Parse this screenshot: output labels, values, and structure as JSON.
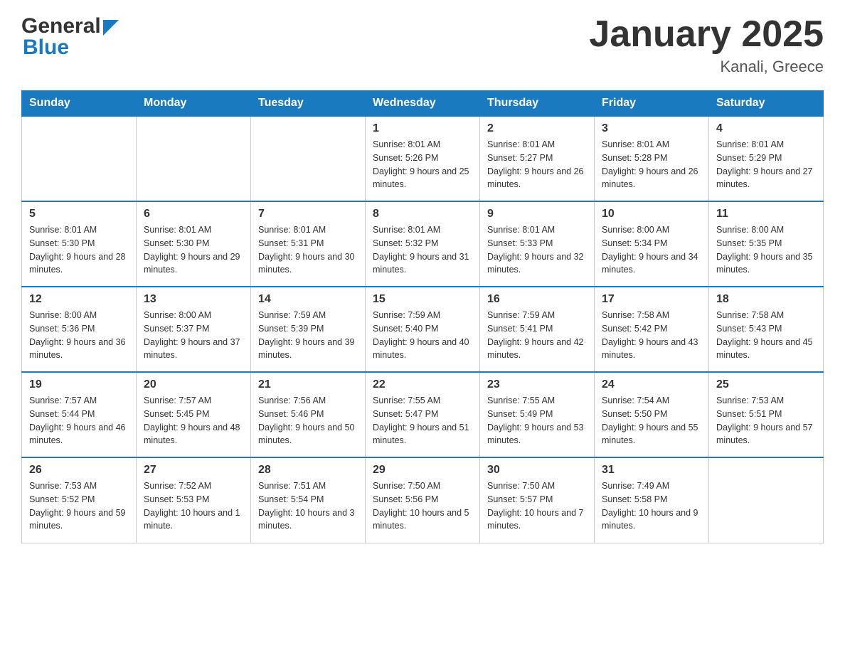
{
  "header": {
    "logo_general": "General",
    "logo_blue": "Blue",
    "title": "January 2025",
    "subtitle": "Kanali, Greece"
  },
  "days_of_week": [
    "Sunday",
    "Monday",
    "Tuesday",
    "Wednesday",
    "Thursday",
    "Friday",
    "Saturday"
  ],
  "weeks": [
    [
      {
        "day": "",
        "sunrise": "",
        "sunset": "",
        "daylight": ""
      },
      {
        "day": "",
        "sunrise": "",
        "sunset": "",
        "daylight": ""
      },
      {
        "day": "",
        "sunrise": "",
        "sunset": "",
        "daylight": ""
      },
      {
        "day": "1",
        "sunrise": "Sunrise: 8:01 AM",
        "sunset": "Sunset: 5:26 PM",
        "daylight": "Daylight: 9 hours and 25 minutes."
      },
      {
        "day": "2",
        "sunrise": "Sunrise: 8:01 AM",
        "sunset": "Sunset: 5:27 PM",
        "daylight": "Daylight: 9 hours and 26 minutes."
      },
      {
        "day": "3",
        "sunrise": "Sunrise: 8:01 AM",
        "sunset": "Sunset: 5:28 PM",
        "daylight": "Daylight: 9 hours and 26 minutes."
      },
      {
        "day": "4",
        "sunrise": "Sunrise: 8:01 AM",
        "sunset": "Sunset: 5:29 PM",
        "daylight": "Daylight: 9 hours and 27 minutes."
      }
    ],
    [
      {
        "day": "5",
        "sunrise": "Sunrise: 8:01 AM",
        "sunset": "Sunset: 5:30 PM",
        "daylight": "Daylight: 9 hours and 28 minutes."
      },
      {
        "day": "6",
        "sunrise": "Sunrise: 8:01 AM",
        "sunset": "Sunset: 5:30 PM",
        "daylight": "Daylight: 9 hours and 29 minutes."
      },
      {
        "day": "7",
        "sunrise": "Sunrise: 8:01 AM",
        "sunset": "Sunset: 5:31 PM",
        "daylight": "Daylight: 9 hours and 30 minutes."
      },
      {
        "day": "8",
        "sunrise": "Sunrise: 8:01 AM",
        "sunset": "Sunset: 5:32 PM",
        "daylight": "Daylight: 9 hours and 31 minutes."
      },
      {
        "day": "9",
        "sunrise": "Sunrise: 8:01 AM",
        "sunset": "Sunset: 5:33 PM",
        "daylight": "Daylight: 9 hours and 32 minutes."
      },
      {
        "day": "10",
        "sunrise": "Sunrise: 8:00 AM",
        "sunset": "Sunset: 5:34 PM",
        "daylight": "Daylight: 9 hours and 34 minutes."
      },
      {
        "day": "11",
        "sunrise": "Sunrise: 8:00 AM",
        "sunset": "Sunset: 5:35 PM",
        "daylight": "Daylight: 9 hours and 35 minutes."
      }
    ],
    [
      {
        "day": "12",
        "sunrise": "Sunrise: 8:00 AM",
        "sunset": "Sunset: 5:36 PM",
        "daylight": "Daylight: 9 hours and 36 minutes."
      },
      {
        "day": "13",
        "sunrise": "Sunrise: 8:00 AM",
        "sunset": "Sunset: 5:37 PM",
        "daylight": "Daylight: 9 hours and 37 minutes."
      },
      {
        "day": "14",
        "sunrise": "Sunrise: 7:59 AM",
        "sunset": "Sunset: 5:39 PM",
        "daylight": "Daylight: 9 hours and 39 minutes."
      },
      {
        "day": "15",
        "sunrise": "Sunrise: 7:59 AM",
        "sunset": "Sunset: 5:40 PM",
        "daylight": "Daylight: 9 hours and 40 minutes."
      },
      {
        "day": "16",
        "sunrise": "Sunrise: 7:59 AM",
        "sunset": "Sunset: 5:41 PM",
        "daylight": "Daylight: 9 hours and 42 minutes."
      },
      {
        "day": "17",
        "sunrise": "Sunrise: 7:58 AM",
        "sunset": "Sunset: 5:42 PM",
        "daylight": "Daylight: 9 hours and 43 minutes."
      },
      {
        "day": "18",
        "sunrise": "Sunrise: 7:58 AM",
        "sunset": "Sunset: 5:43 PM",
        "daylight": "Daylight: 9 hours and 45 minutes."
      }
    ],
    [
      {
        "day": "19",
        "sunrise": "Sunrise: 7:57 AM",
        "sunset": "Sunset: 5:44 PM",
        "daylight": "Daylight: 9 hours and 46 minutes."
      },
      {
        "day": "20",
        "sunrise": "Sunrise: 7:57 AM",
        "sunset": "Sunset: 5:45 PM",
        "daylight": "Daylight: 9 hours and 48 minutes."
      },
      {
        "day": "21",
        "sunrise": "Sunrise: 7:56 AM",
        "sunset": "Sunset: 5:46 PM",
        "daylight": "Daylight: 9 hours and 50 minutes."
      },
      {
        "day": "22",
        "sunrise": "Sunrise: 7:55 AM",
        "sunset": "Sunset: 5:47 PM",
        "daylight": "Daylight: 9 hours and 51 minutes."
      },
      {
        "day": "23",
        "sunrise": "Sunrise: 7:55 AM",
        "sunset": "Sunset: 5:49 PM",
        "daylight": "Daylight: 9 hours and 53 minutes."
      },
      {
        "day": "24",
        "sunrise": "Sunrise: 7:54 AM",
        "sunset": "Sunset: 5:50 PM",
        "daylight": "Daylight: 9 hours and 55 minutes."
      },
      {
        "day": "25",
        "sunrise": "Sunrise: 7:53 AM",
        "sunset": "Sunset: 5:51 PM",
        "daylight": "Daylight: 9 hours and 57 minutes."
      }
    ],
    [
      {
        "day": "26",
        "sunrise": "Sunrise: 7:53 AM",
        "sunset": "Sunset: 5:52 PM",
        "daylight": "Daylight: 9 hours and 59 minutes."
      },
      {
        "day": "27",
        "sunrise": "Sunrise: 7:52 AM",
        "sunset": "Sunset: 5:53 PM",
        "daylight": "Daylight: 10 hours and 1 minute."
      },
      {
        "day": "28",
        "sunrise": "Sunrise: 7:51 AM",
        "sunset": "Sunset: 5:54 PM",
        "daylight": "Daylight: 10 hours and 3 minutes."
      },
      {
        "day": "29",
        "sunrise": "Sunrise: 7:50 AM",
        "sunset": "Sunset: 5:56 PM",
        "daylight": "Daylight: 10 hours and 5 minutes."
      },
      {
        "day": "30",
        "sunrise": "Sunrise: 7:50 AM",
        "sunset": "Sunset: 5:57 PM",
        "daylight": "Daylight: 10 hours and 7 minutes."
      },
      {
        "day": "31",
        "sunrise": "Sunrise: 7:49 AM",
        "sunset": "Sunset: 5:58 PM",
        "daylight": "Daylight: 10 hours and 9 minutes."
      },
      {
        "day": "",
        "sunrise": "",
        "sunset": "",
        "daylight": ""
      }
    ]
  ]
}
